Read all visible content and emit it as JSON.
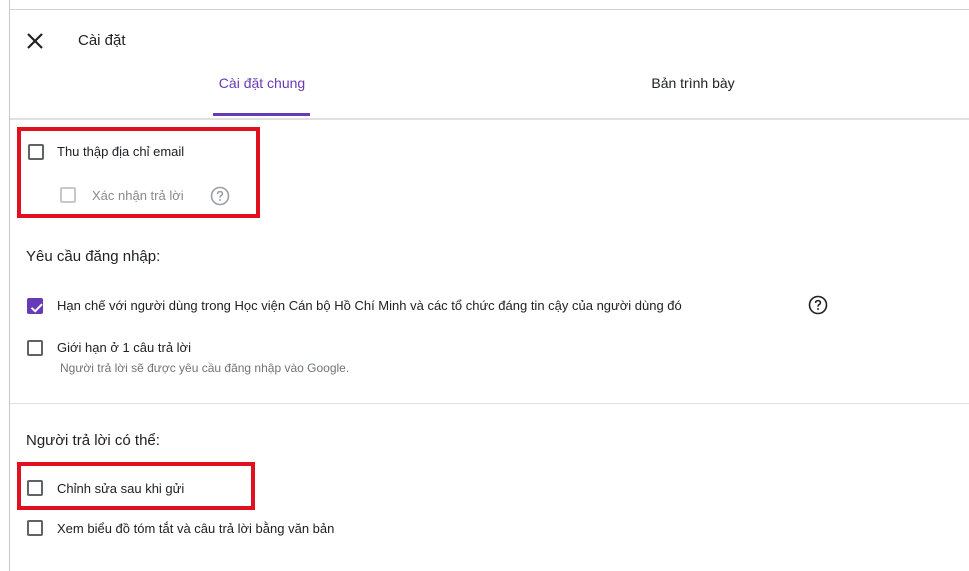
{
  "header": {
    "title": "Cài đặt"
  },
  "tabs": [
    {
      "label": "Cài đặt chung",
      "active": true
    },
    {
      "label": "Bản trình bày",
      "active": false
    }
  ],
  "email_section": {
    "collect_email": {
      "label": "Thu thập địa chỉ email",
      "checked": false
    },
    "confirm_response": {
      "label": "Xác nhận trả lời",
      "checked": false,
      "enabled": false
    }
  },
  "login_section": {
    "heading": "Yêu cầu đăng nhập:",
    "restrict": {
      "label": "Hạn chế với người dùng trong Học viện Cán bộ Hồ Chí Minh và các tổ chức đáng tin cậy của người dùng đó",
      "checked": true
    },
    "limit_one": {
      "label": "Giới hạn ở 1 câu trả lời",
      "hint": "Người trả lời sẽ được yêu cầu đăng nhập vào Google.",
      "checked": false
    }
  },
  "respondent_section": {
    "heading": "Người trả lời có thể:",
    "edit_after_submit": {
      "label": "Chỉnh sửa sau khi gửi",
      "checked": false
    },
    "see_summary": {
      "label": "Xem biểu đồ tóm tắt và câu trả lời bằng văn bản",
      "checked": false
    }
  },
  "colors": {
    "accent": "#673ab7",
    "highlight": "#e0101e"
  },
  "icons": {
    "close": "close-icon",
    "help": "help-circle-icon",
    "check": "checkmark-icon"
  }
}
